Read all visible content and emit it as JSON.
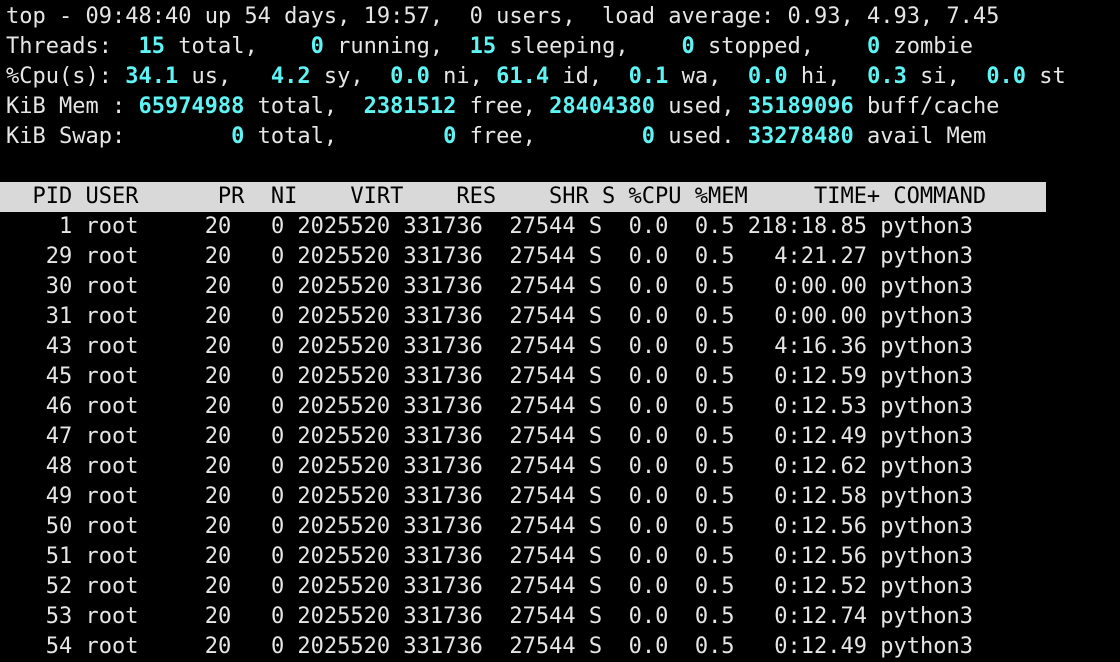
{
  "summary": {
    "top": {
      "prefix": "top - ",
      "time": "09:48:40",
      "uptime_label": " up 54 days, 19:57,  0 users,  load average: ",
      "load": "0.93, 4.93, 7.45"
    },
    "threads": {
      "label": "Threads: ",
      "total_val": " 15",
      "total_lbl": " total,   ",
      "running_val": " 0",
      "running_lbl": " running,  ",
      "sleeping_val": "15",
      "sleeping_lbl": " sleeping,   ",
      "stopped_val": " 0",
      "stopped_lbl": " stopped,   ",
      "zombie_val": " 0",
      "zombie_lbl": " zombie"
    },
    "cpu": {
      "label": "%Cpu(s): ",
      "us_val": "34.1",
      "us_lbl": " us,  ",
      "sy_val": " 4.2",
      "sy_lbl": " sy,  ",
      "ni_val": "0.0",
      "ni_lbl": " ni, ",
      "id_val": "61.4",
      "id_lbl": " id,  ",
      "wa_val": "0.1",
      "wa_lbl": " wa,  ",
      "hi_val": "0.0",
      "hi_lbl": " hi,  ",
      "si_val": "0.3",
      "si_lbl": " si,  ",
      "st_val": "0.0",
      "st_lbl": " st"
    },
    "mem": {
      "label": "KiB Mem : ",
      "total_val": "65974988",
      "total_lbl": " total,  ",
      "free_val": "2381512",
      "free_lbl": " free, ",
      "used_val": "28404380",
      "used_lbl": " used, ",
      "buff_val": "35189096",
      "buff_lbl": " buff/cache"
    },
    "swap": {
      "label": "KiB Swap: ",
      "total_val": "       0",
      "total_lbl": " total,  ",
      "free_val": "      0",
      "free_lbl": " free, ",
      "used_val": "       0",
      "used_lbl": " used. ",
      "avail_val": "33278480",
      "avail_lbl": " avail Mem"
    }
  },
  "table": {
    "header": "  PID USER      PR  NI    VIRT    RES    SHR S %CPU %MEM     TIME+ COMMAND",
    "rows": [
      {
        "pid": "1",
        "user": "root",
        "pr": "20",
        "ni": "0",
        "virt": "2025520",
        "res": "331736",
        "shr": "27544",
        "s": "S",
        "cpu": "0.0",
        "mem": "0.5",
        "time": "218:18.85",
        "command": "python3"
      },
      {
        "pid": "29",
        "user": "root",
        "pr": "20",
        "ni": "0",
        "virt": "2025520",
        "res": "331736",
        "shr": "27544",
        "s": "S",
        "cpu": "0.0",
        "mem": "0.5",
        "time": "4:21.27",
        "command": "python3"
      },
      {
        "pid": "30",
        "user": "root",
        "pr": "20",
        "ni": "0",
        "virt": "2025520",
        "res": "331736",
        "shr": "27544",
        "s": "S",
        "cpu": "0.0",
        "mem": "0.5",
        "time": "0:00.00",
        "command": "python3"
      },
      {
        "pid": "31",
        "user": "root",
        "pr": "20",
        "ni": "0",
        "virt": "2025520",
        "res": "331736",
        "shr": "27544",
        "s": "S",
        "cpu": "0.0",
        "mem": "0.5",
        "time": "0:00.00",
        "command": "python3"
      },
      {
        "pid": "43",
        "user": "root",
        "pr": "20",
        "ni": "0",
        "virt": "2025520",
        "res": "331736",
        "shr": "27544",
        "s": "S",
        "cpu": "0.0",
        "mem": "0.5",
        "time": "4:16.36",
        "command": "python3"
      },
      {
        "pid": "45",
        "user": "root",
        "pr": "20",
        "ni": "0",
        "virt": "2025520",
        "res": "331736",
        "shr": "27544",
        "s": "S",
        "cpu": "0.0",
        "mem": "0.5",
        "time": "0:12.59",
        "command": "python3"
      },
      {
        "pid": "46",
        "user": "root",
        "pr": "20",
        "ni": "0",
        "virt": "2025520",
        "res": "331736",
        "shr": "27544",
        "s": "S",
        "cpu": "0.0",
        "mem": "0.5",
        "time": "0:12.53",
        "command": "python3"
      },
      {
        "pid": "47",
        "user": "root",
        "pr": "20",
        "ni": "0",
        "virt": "2025520",
        "res": "331736",
        "shr": "27544",
        "s": "S",
        "cpu": "0.0",
        "mem": "0.5",
        "time": "0:12.49",
        "command": "python3"
      },
      {
        "pid": "48",
        "user": "root",
        "pr": "20",
        "ni": "0",
        "virt": "2025520",
        "res": "331736",
        "shr": "27544",
        "s": "S",
        "cpu": "0.0",
        "mem": "0.5",
        "time": "0:12.62",
        "command": "python3"
      },
      {
        "pid": "49",
        "user": "root",
        "pr": "20",
        "ni": "0",
        "virt": "2025520",
        "res": "331736",
        "shr": "27544",
        "s": "S",
        "cpu": "0.0",
        "mem": "0.5",
        "time": "0:12.58",
        "command": "python3"
      },
      {
        "pid": "50",
        "user": "root",
        "pr": "20",
        "ni": "0",
        "virt": "2025520",
        "res": "331736",
        "shr": "27544",
        "s": "S",
        "cpu": "0.0",
        "mem": "0.5",
        "time": "0:12.56",
        "command": "python3"
      },
      {
        "pid": "51",
        "user": "root",
        "pr": "20",
        "ni": "0",
        "virt": "2025520",
        "res": "331736",
        "shr": "27544",
        "s": "S",
        "cpu": "0.0",
        "mem": "0.5",
        "time": "0:12.56",
        "command": "python3"
      },
      {
        "pid": "52",
        "user": "root",
        "pr": "20",
        "ni": "0",
        "virt": "2025520",
        "res": "331736",
        "shr": "27544",
        "s": "S",
        "cpu": "0.0",
        "mem": "0.5",
        "time": "0:12.52",
        "command": "python3"
      },
      {
        "pid": "53",
        "user": "root",
        "pr": "20",
        "ni": "0",
        "virt": "2025520",
        "res": "331736",
        "shr": "27544",
        "s": "S",
        "cpu": "0.0",
        "mem": "0.5",
        "time": "0:12.74",
        "command": "python3"
      },
      {
        "pid": "54",
        "user": "root",
        "pr": "20",
        "ni": "0",
        "virt": "2025520",
        "res": "331736",
        "shr": "27544",
        "s": "S",
        "cpu": "0.0",
        "mem": "0.5",
        "time": "0:12.49",
        "command": "python3"
      }
    ]
  },
  "colors": {
    "background": "#000000",
    "text": "#e6e6e6",
    "highlight": "#5ff4f4",
    "header_bg": "#d9d9d9",
    "header_text": "#000000"
  }
}
